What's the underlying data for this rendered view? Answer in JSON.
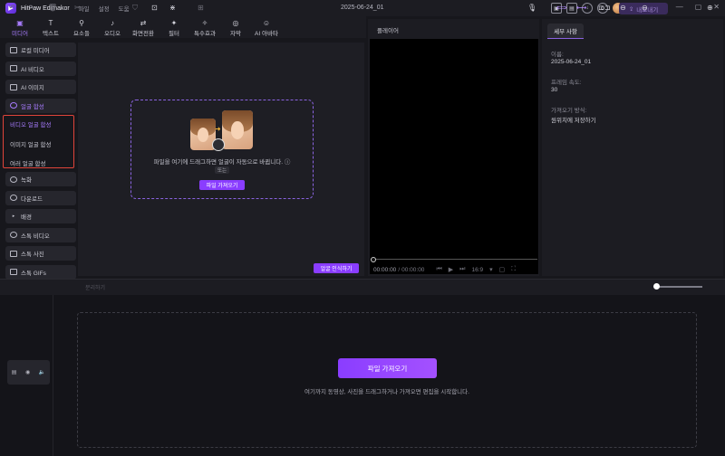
{
  "titlebar": {
    "app_name": "HitPaw Edimakor",
    "menu": [
      "파일",
      "설정",
      "도움"
    ],
    "doc_title": "2025-06-24_01",
    "export_label": "내보내기",
    "icons": [
      "gift-icon",
      "chat-icon",
      "download-icon",
      "settings-icon",
      "avatar"
    ]
  },
  "toolbar": {
    "tabs": [
      {
        "label": "미디어",
        "icon": "▣",
        "active": true
      },
      {
        "label": "텍스트",
        "icon": "T"
      },
      {
        "label": "요소들",
        "icon": "⚲"
      },
      {
        "label": "오디오",
        "icon": "♪"
      },
      {
        "label": "화면전환",
        "icon": "⇄"
      },
      {
        "label": "필터",
        "icon": "✦"
      },
      {
        "label": "특수효과",
        "icon": "✧"
      },
      {
        "label": "자막",
        "icon": "◎"
      },
      {
        "label": "AI 아바타",
        "icon": "☺"
      }
    ]
  },
  "sidebar": {
    "items": [
      {
        "label": "로컬 미디어",
        "icon": "▭"
      },
      {
        "label": "AI 비디오",
        "icon": "▭"
      },
      {
        "label": "AI 이미지",
        "icon": "▭"
      },
      {
        "label": "얼굴 합성",
        "icon": "◐",
        "active": true
      },
      {
        "label": "녹화",
        "icon": "●"
      },
      {
        "label": "다운로드",
        "icon": "↓"
      },
      {
        "label": "배경",
        "icon": "▸"
      },
      {
        "label": "스톡 비디오",
        "icon": "▶"
      },
      {
        "label": "스톡 사진",
        "icon": "▭"
      },
      {
        "label": "스톡 GIFs",
        "icon": "▭"
      }
    ],
    "sub_items": [
      {
        "label": "비디오 얼굴 합성",
        "active": true
      },
      {
        "label": "이미지 얼굴 합성"
      },
      {
        "label": "여러 얼굴 합성"
      }
    ]
  },
  "media": {
    "drop_text": "파일을 여기에 드래그하면 얼굴이 자동으로 바뀝니다.",
    "or_label": "또는",
    "import_label": "파일 가져오기",
    "face_detect_label": "얼굴 인식하기"
  },
  "player": {
    "title": "플레이어",
    "time_current": "00:00:00",
    "time_total": "00:00:00",
    "ratio": "16:9",
    "progress": 0
  },
  "details": {
    "tab_label": "세부 사항",
    "fields": [
      {
        "label": "이름:",
        "value": "2025-06-24_01"
      },
      {
        "label": "프레임 속도:",
        "value": "30"
      },
      {
        "label": "가져오기 방식:",
        "value": "원위치에 저장하기"
      }
    ]
  },
  "timeline": {
    "cut_label": "분리하기",
    "import_label": "파일 가져오기",
    "hint": "여기까지 동영상, 사진을 드래그하거나 가져오면 편집을 시작합니다.",
    "zoom_level": 0
  }
}
